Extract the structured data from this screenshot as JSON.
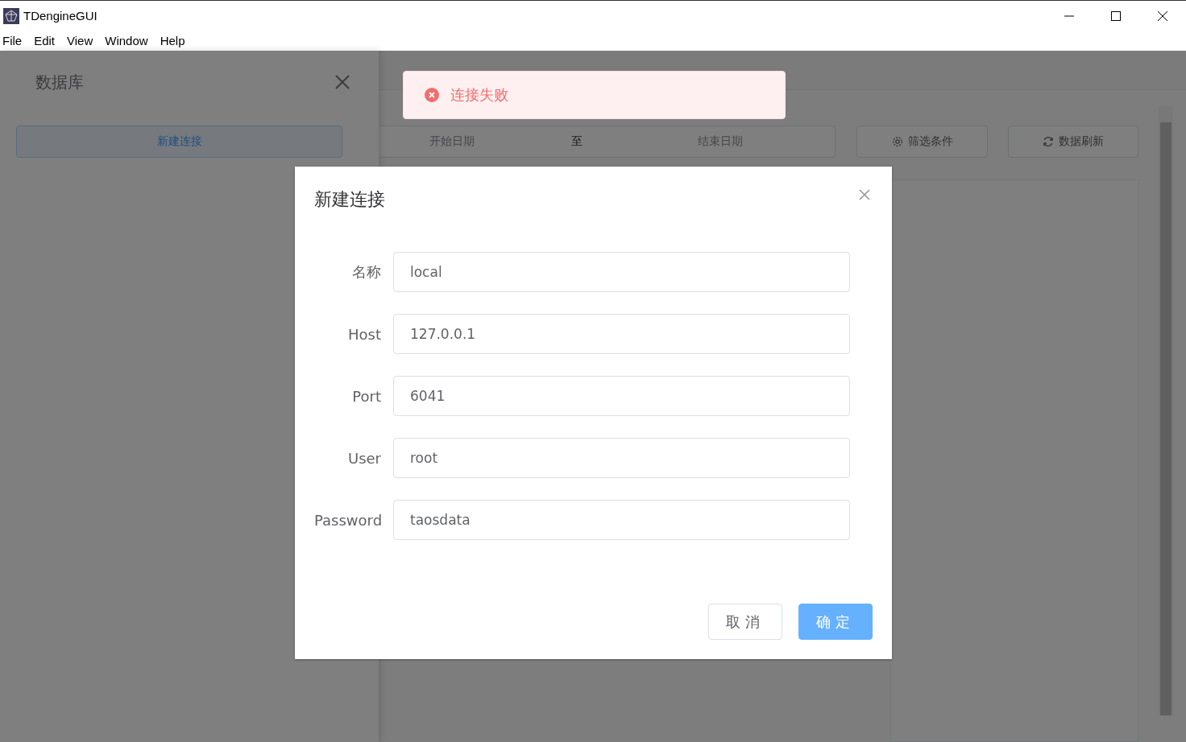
{
  "window": {
    "title": "TDengineGUI"
  },
  "menu": [
    "File",
    "Edit",
    "View",
    "Window",
    "Help"
  ],
  "drawer": {
    "title": "数据库",
    "new_connection_button": "新建连接"
  },
  "toolbar": {
    "start_placeholder": "开始日期",
    "separator": "至",
    "end_placeholder": "结束日期",
    "filter_button": "筛选条件",
    "refresh_button": "数据刷新"
  },
  "message": {
    "kind": "error",
    "text": "连接失败"
  },
  "dialog": {
    "title": "新建连接",
    "fields": [
      {
        "label": "名称",
        "value": "local"
      },
      {
        "label": "Host",
        "value": "127.0.0.1"
      },
      {
        "label": "Port",
        "value": "6041"
      },
      {
        "label": "User",
        "value": "root"
      },
      {
        "label": "Password",
        "value": "taosdata"
      }
    ],
    "buttons": [
      {
        "label": "取消",
        "kind": "default"
      },
      {
        "label": "确定",
        "kind": "primary"
      }
    ]
  }
}
